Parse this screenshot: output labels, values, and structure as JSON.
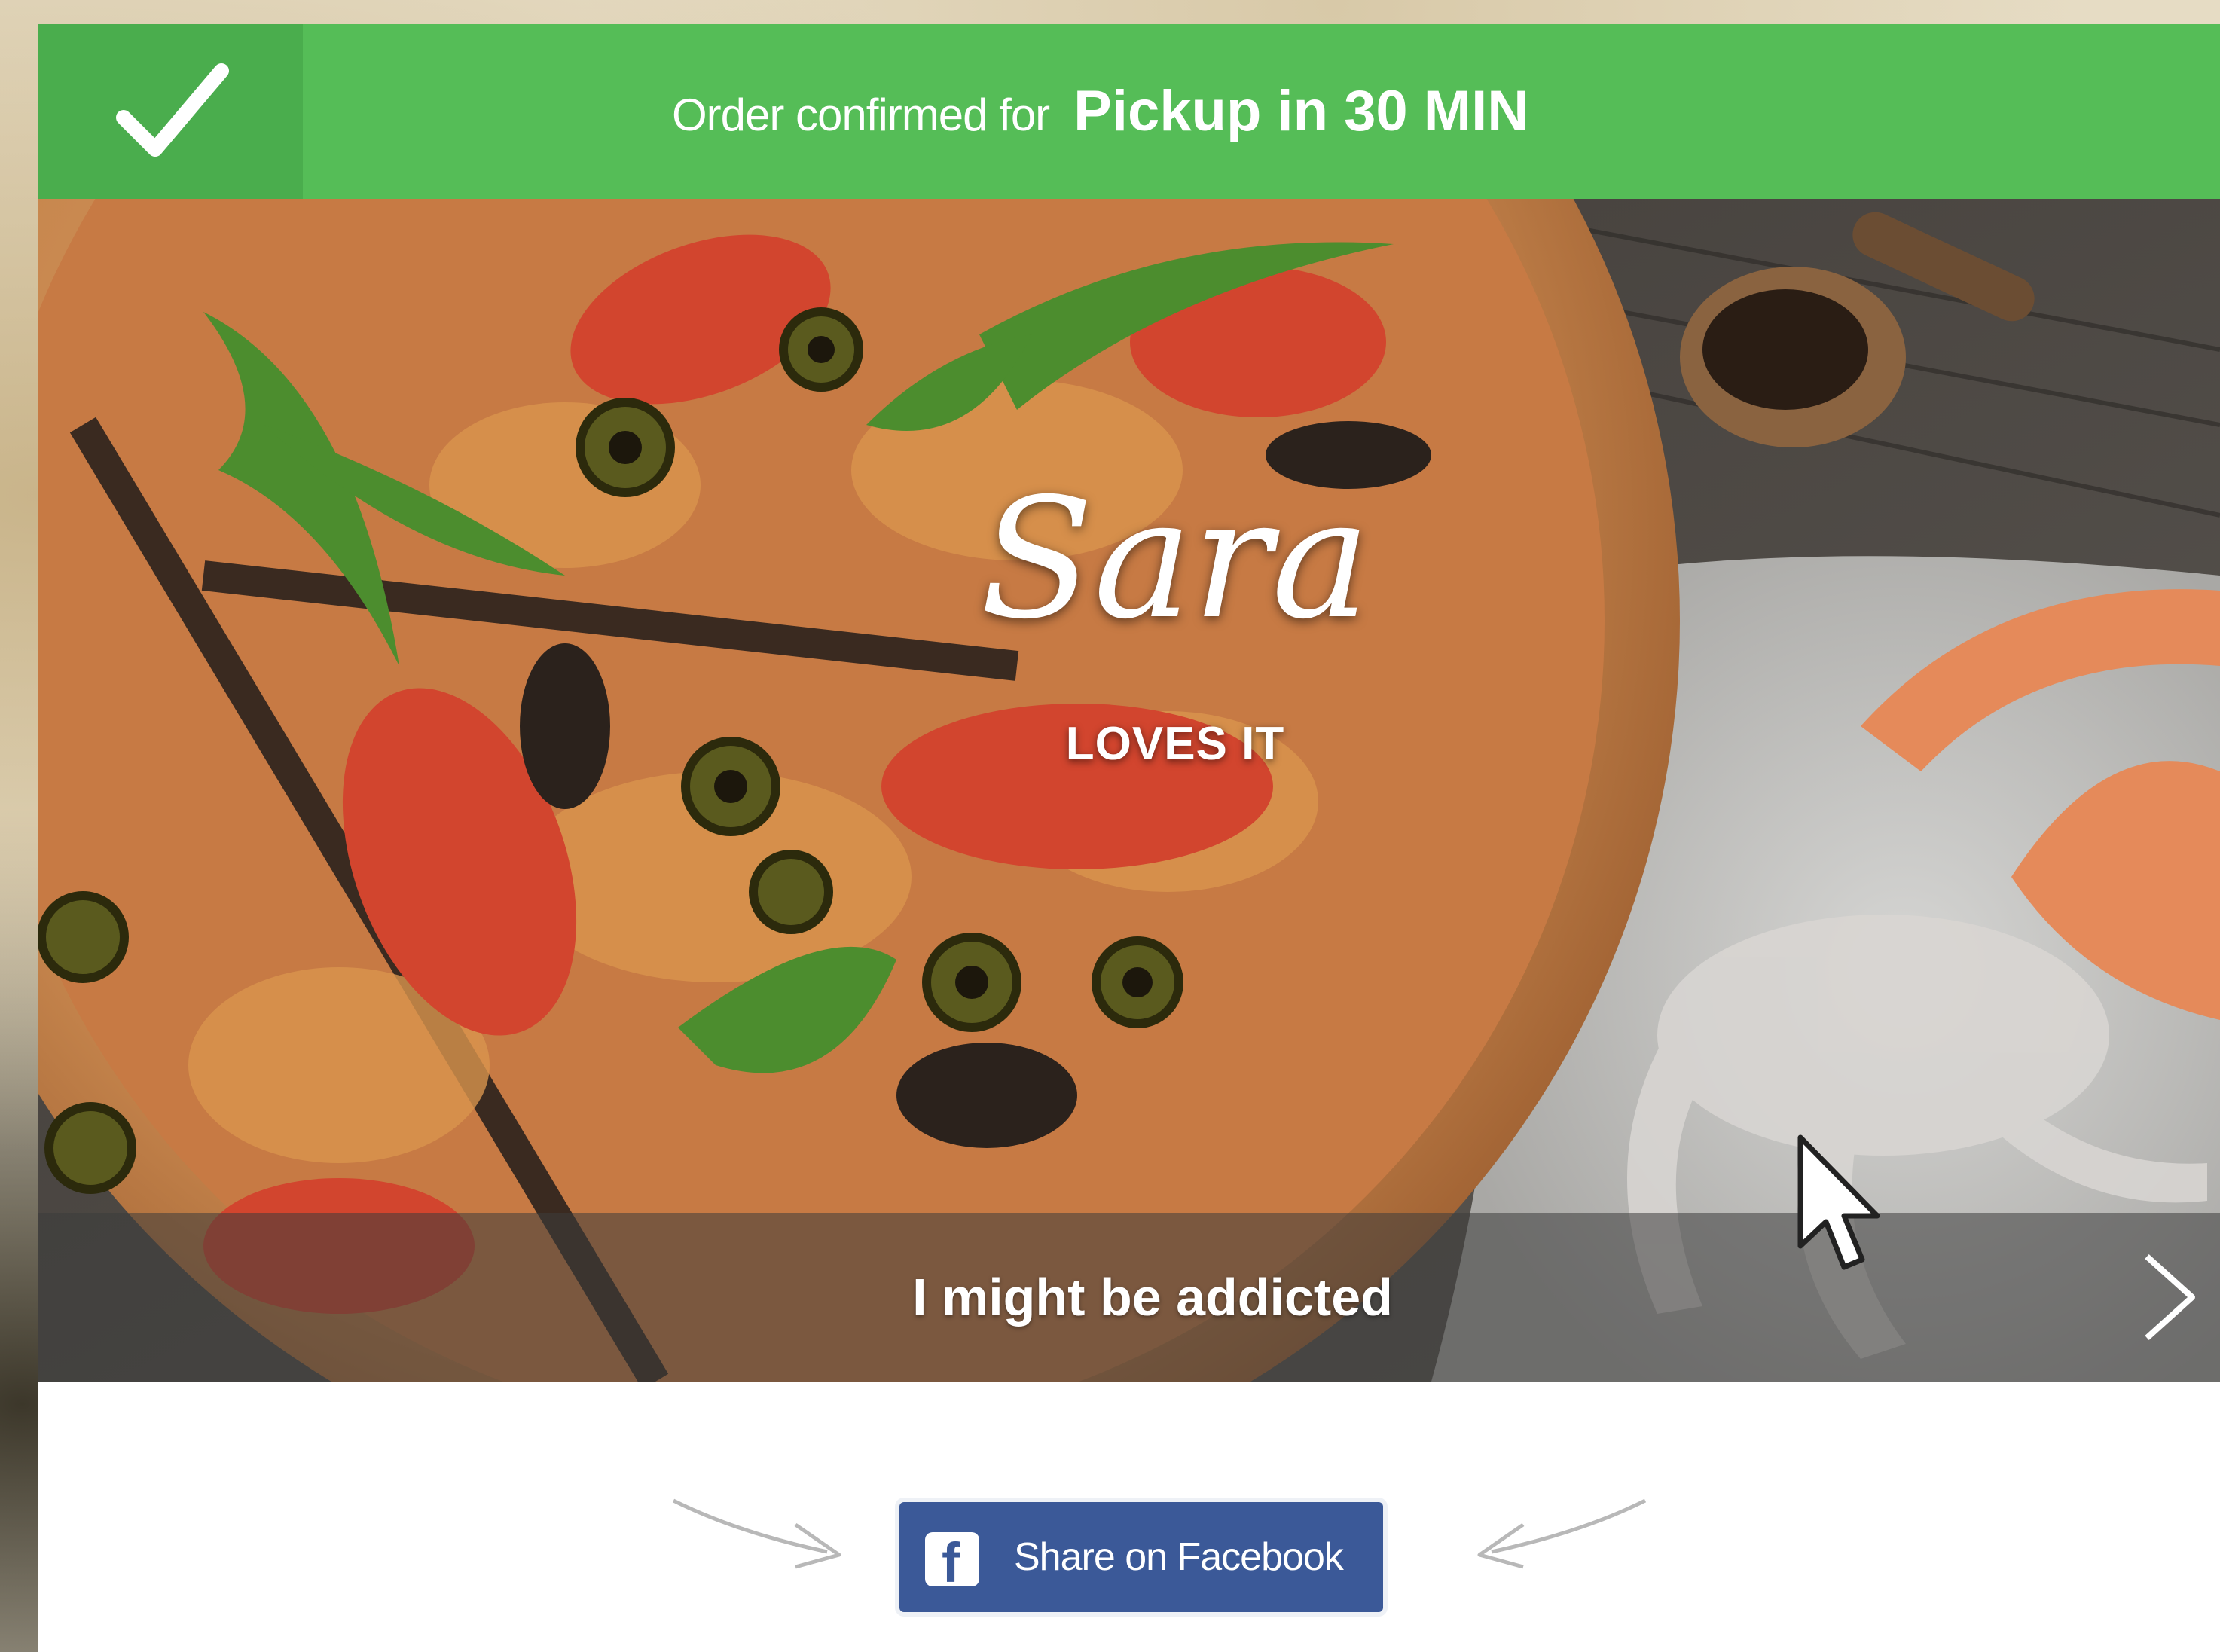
{
  "confirmation": {
    "prefix": "Order confirmed for",
    "highlight": "Pickup in 30 MIN",
    "color": "#55bd57"
  },
  "hero": {
    "name": "Sara",
    "subtitle": "LOVES IT",
    "caption": "I might be addicted"
  },
  "share": {
    "button_label": "Share on Facebook",
    "button_color": "#3b5998",
    "icon_glyph": "f"
  },
  "icons": {
    "confirm": "checkmark-icon",
    "next": "chevron-right-icon",
    "cursor": "mouse-cursor-icon",
    "facebook": "facebook-icon"
  }
}
